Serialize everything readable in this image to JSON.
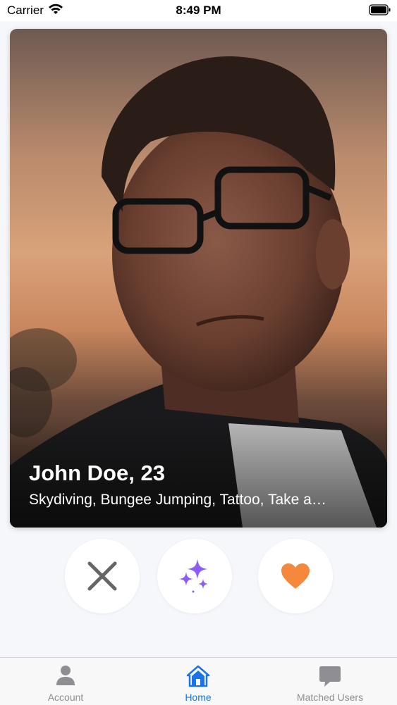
{
  "status_bar": {
    "carrier": "Carrier",
    "time": "8:49 PM"
  },
  "card": {
    "name": "John Doe, 23",
    "interests": "Skydiving, Bungee Jumping, Tattoo, Take a…",
    "photo": "profile-photo"
  },
  "actions": [
    {
      "icon": "close-icon",
      "color": "#666666"
    },
    {
      "icon": "sparkles-icon",
      "color": "#8b5cf6"
    },
    {
      "icon": "heart-icon",
      "color": "#f5883c"
    }
  ],
  "tabs": [
    {
      "label": "Account",
      "icon": "person-icon",
      "active": false
    },
    {
      "label": "Home",
      "icon": "home-icon",
      "active": true
    },
    {
      "label": "Matched Users",
      "icon": "chat-bubble-icon",
      "active": false
    }
  ],
  "colors": {
    "accent": "#1a73e8",
    "inactive": "#8e8e93"
  }
}
